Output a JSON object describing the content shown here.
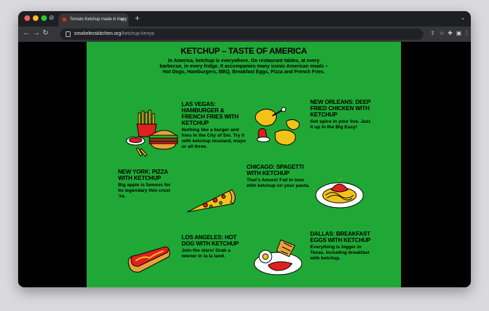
{
  "browser": {
    "tab_title": "Tomato Ketchup made in Keny",
    "url_domain": "smokelesskitchen.org",
    "url_path": "/ketchup-kenya"
  },
  "page": {
    "heading": "KETCHUP – TASTE OF AMERICA",
    "intro": "In America, ketchup is everywhere. On restaurant tables, at every barbecue, in every fridge. It accompanies many iconic American meals – Hot Dogs, Hamburgers, BBQ, Breakfast Eggs, Pizza and French Fries.",
    "sections": {
      "las_vegas": {
        "title": "LAS VEGAS: HAMBURGER & FRENCH FRIES WITH KETCHUP",
        "text": "Nothing like a burger and fries in the City of Sin. Try it with ketchup mustard, mayo or all three."
      },
      "new_orleans": {
        "title": "NEW ORLEANS: DEEP FRIED CHICKEN WITH KETCHUP",
        "text": "Get spice in your live. Jazz it up in the Big Easy!"
      },
      "new_york": {
        "title": "NEW YORK: PIZZA WITH KETCHUP",
        "text": "Big apple is famous for its legendary thin crust 'za."
      },
      "chicago": {
        "title": "CHICAGO: SPAGETTI WITH KETCHUP",
        "text": "That's Amore! Fall in love with ketchup on your pasta."
      },
      "los_angeles": {
        "title": "LOS ANGELES: HOT DOG WITH KETCHUP",
        "text": "Join the stars! Grab a wiener in la la land."
      },
      "dallas": {
        "title": "DALLAS: BREAKFAST EGGS WITH KETCHUP",
        "text": "Everything is bigger in Texas. Including breakfast with ketchup."
      }
    }
  },
  "colors": {
    "page_bg": "#1fa835",
    "ketchup": "#e02020",
    "outline": "#000000"
  }
}
